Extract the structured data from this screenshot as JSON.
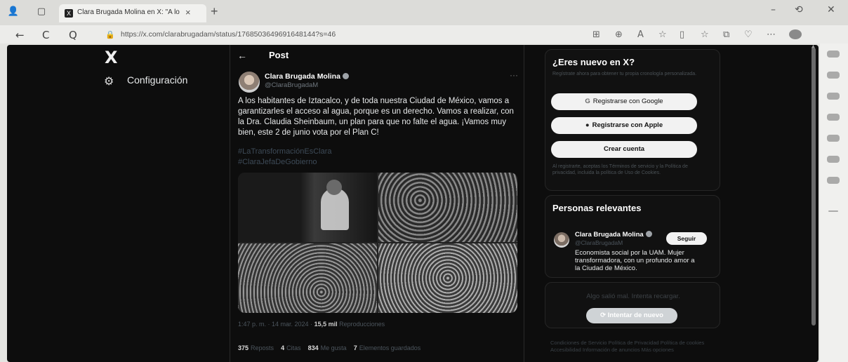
{
  "browser": {
    "tab_title": "Clara Brugada Molina en X: \"A lo",
    "tab_close": "×",
    "new_tab": "+",
    "url": "https://x.com/clarabrugadam/status/1768503649691648144?s=46",
    "nav": {
      "back": "←",
      "reload": "C",
      "search": "Q"
    },
    "window": {
      "minimize": "–",
      "restore": "⟲",
      "close": "✕"
    }
  },
  "sidebar": {
    "logo": "X",
    "settings_label": "Configuración"
  },
  "post": {
    "header": "Post",
    "back_arrow": "←",
    "author": "Clara Brugada Molina",
    "handle": "@ClaraBrugadaM",
    "more": "···",
    "text": "A los habitantes de Iztacalco, y de toda nuestra Ciudad de México, vamos a garantizarles el acceso al agua, porque es un derecho. Vamos a realizar, con la Dra. Claudia Sheinbaum, un plan para que no falte el agua. ¡Vamos muy bien, este 2 de junio vota por el Plan C!",
    "hashtags": [
      "#LaTransformaciónEsClara",
      "#ClaraJefaDeGobierno"
    ],
    "timestamp": "1:47 p. m. · 14 mar. 2024 · ",
    "views_count": "15,5 mil",
    "views_label": " Reproducciones",
    "stats": [
      {
        "count": "375",
        "label": "Reposts"
      },
      {
        "count": "4",
        "label": "Citas"
      },
      {
        "count": "834",
        "label": "Me gusta"
      },
      {
        "count": "7",
        "label": "Elementos guardados"
      }
    ]
  },
  "signup": {
    "title": "¿Eres nuevo en X?",
    "subtitle": "Regístrate ahora para obtener tu propia cronología personalizada.",
    "google": "Registrarse con Google",
    "apple": "Registrarse con Apple",
    "create": "Crear cuenta",
    "legal": "Al registrarte, aceptas los Términos de servicio y la Política de privacidad, incluida la política de Uso de Cookies."
  },
  "relevant": {
    "title": "Personas relevantes",
    "name": "Clara Brugada Molina",
    "handle": "@ClaraBrugadaM",
    "follow": "Seguir",
    "bio": "Economista social por la UAM. Mujer transformadora, con un profundo amor a la Ciudad de México."
  },
  "error_card": {
    "message": "Algo salió mal. Intenta recargar.",
    "retry": "Intentar de nuevo"
  },
  "footer": "Condiciones de Servicio   Política de Privacidad   Política de cookies   Accesibilidad   Información de anuncios   Más opciones"
}
